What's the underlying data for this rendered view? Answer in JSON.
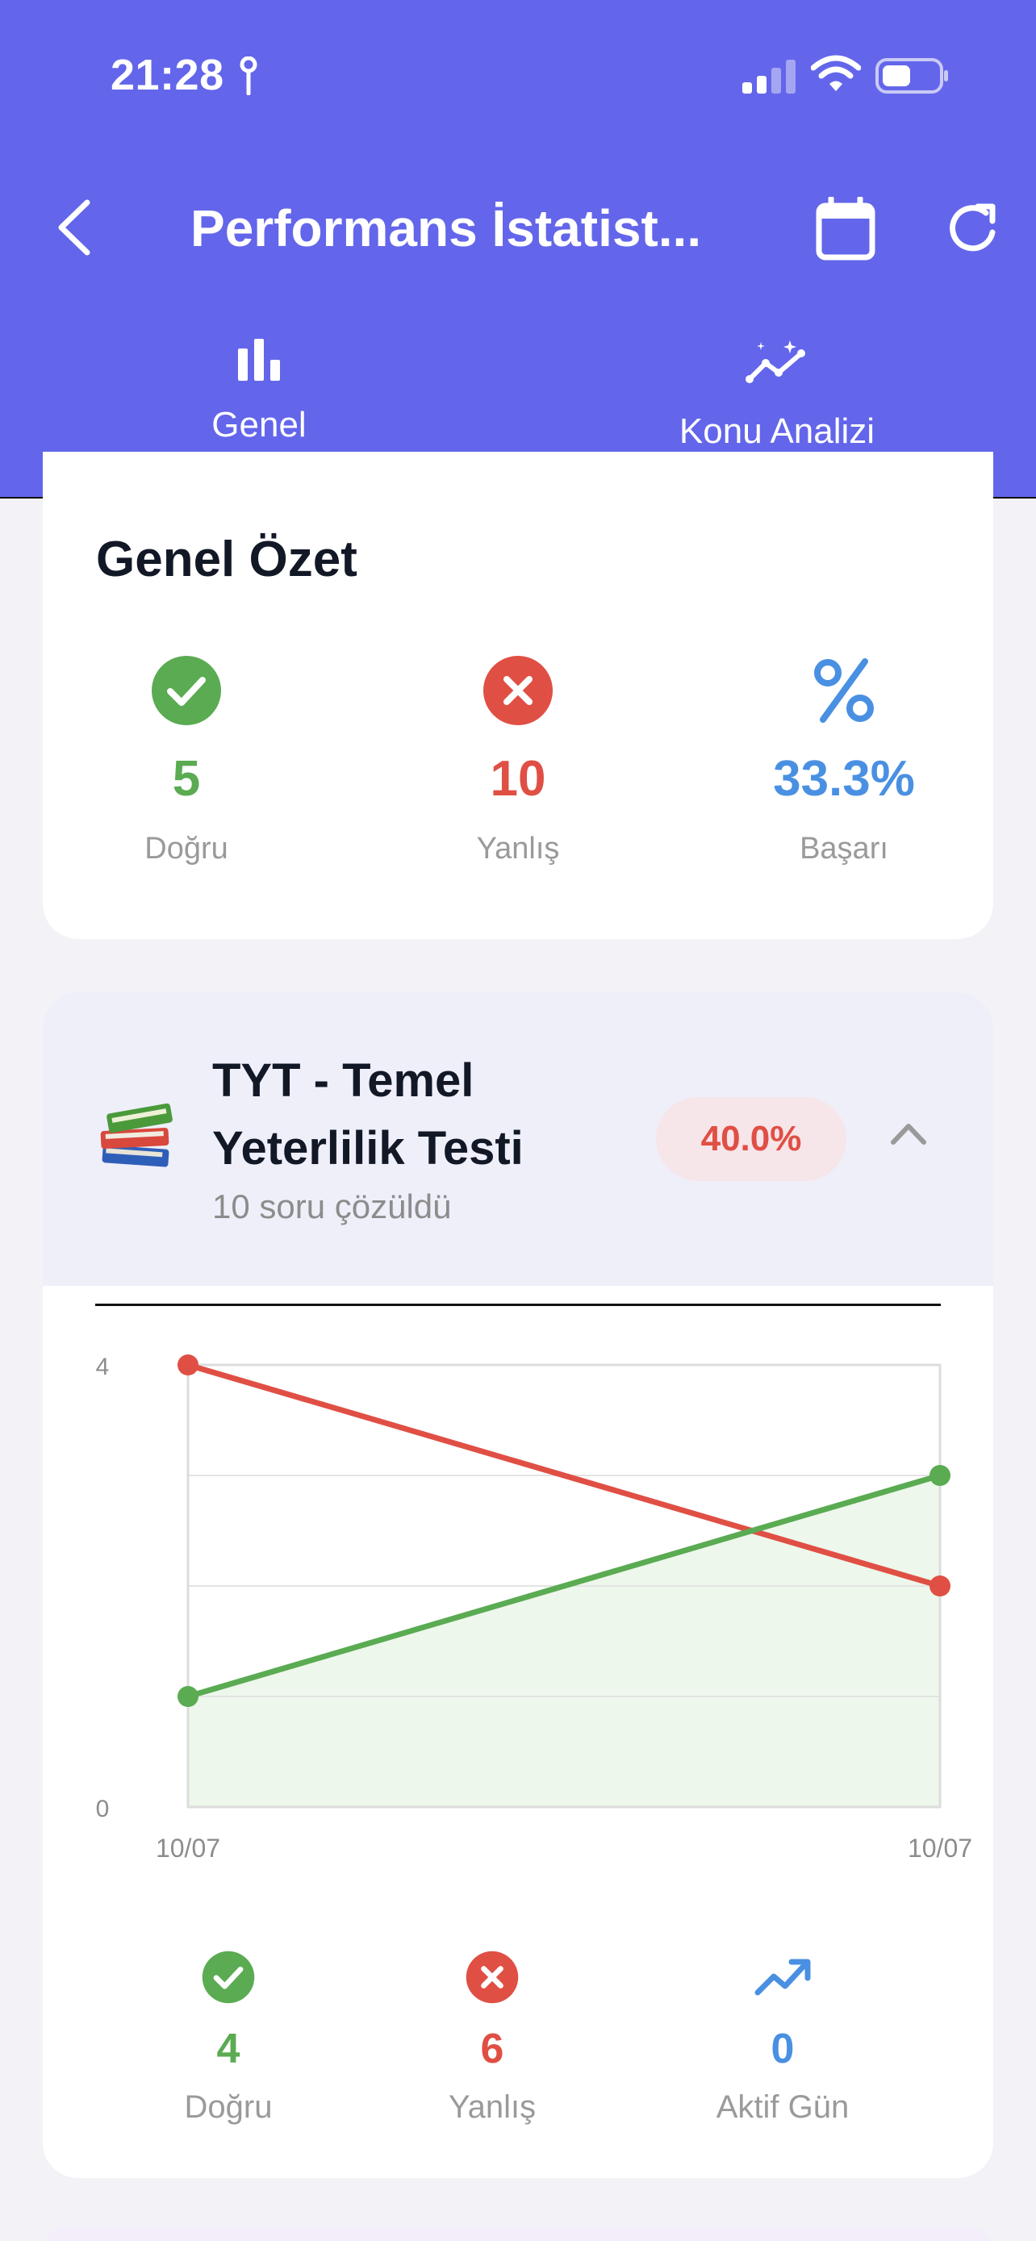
{
  "status_bar": {
    "time": "21:28"
  },
  "header": {
    "title": "Performans İstatist...",
    "tabs": [
      {
        "label": "Genel",
        "icon": "bar-chart-icon",
        "active": true
      },
      {
        "label": "Konu Analizi",
        "icon": "trend-sparkle-icon",
        "active": false
      }
    ]
  },
  "summary": {
    "title": "Genel Özet",
    "stats": [
      {
        "value": "5",
        "label": "Doğru",
        "icon": "check-circle-icon",
        "color": "#5aab52"
      },
      {
        "value": "10",
        "label": "Yanlış",
        "icon": "x-circle-icon",
        "color": "#e04f44"
      },
      {
        "value": "33.3%",
        "label": "Başarı",
        "icon": "percent-icon",
        "color": "#4a90e2"
      }
    ]
  },
  "subject": {
    "emoji": "📚",
    "title": "TYT - Temel Yeterlilik Testi",
    "subtitle": "10 soru çözüldü",
    "rate": "40.0%",
    "mini_stats": [
      {
        "value": "4",
        "label": "Doğru",
        "icon": "check-circle-icon",
        "color": "#5aab52"
      },
      {
        "value": "6",
        "label": "Yanlış",
        "icon": "x-circle-icon",
        "color": "#e04f44"
      },
      {
        "value": "0",
        "label": "Aktif Gün",
        "icon": "trending-up-icon",
        "color": "#4a90e2"
      }
    ]
  },
  "chart_data": {
    "type": "line",
    "x": [
      "10/07",
      "10/07"
    ],
    "ylim": [
      0,
      4
    ],
    "y_ticks": [
      "0",
      "4"
    ],
    "grid": true,
    "series": [
      {
        "values": [
          4,
          2
        ],
        "color": "#e04f44"
      },
      {
        "values": [
          1,
          3
        ],
        "color": "#5aab52",
        "fill": "#eef7ec"
      }
    ]
  }
}
